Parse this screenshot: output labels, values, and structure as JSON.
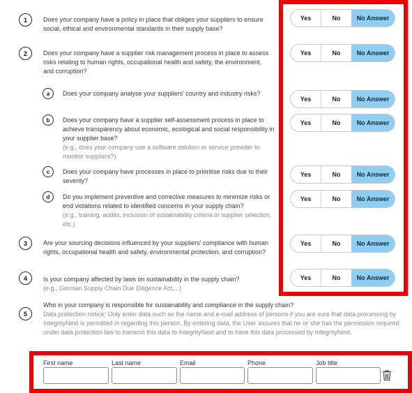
{
  "answer_labels": {
    "yes": "Yes",
    "no": "No",
    "na": "No Answer"
  },
  "questions": [
    {
      "num": "1",
      "text": "Does your company have a policy in place that obliges your suppliers to ensure social, ethical and environmental standards in their supply base?",
      "hint": "",
      "answer": "No Answer"
    },
    {
      "num": "2",
      "text": "Does your company have a supplier risk management process in place to assess risks relating to human rights, occupational health and safety, the environment, and corruption?",
      "hint": "",
      "answer": "No Answer"
    },
    {
      "num": "a",
      "text": "Does your company analyse your suppliers' country and industry risks?",
      "hint": "",
      "answer": "No Answer"
    },
    {
      "num": "b",
      "text": "Does your company have a supplier self-assessment process in place to achieve transparency about economic, ecological and social responsibility in your supplier base?",
      "hint": "(e.g., does your company use a software solution or service provider to monitor suppliers?)",
      "answer": "No Answer"
    },
    {
      "num": "c",
      "text": "Does your company have processes in place to prioritise risks due to their severity?",
      "hint": "",
      "answer": "No Answer"
    },
    {
      "num": "d",
      "text": "Do you implement preventive and corrective measures to minimize risks or end violations related to identified concerns in your supply chain?",
      "hint": "(e.g., training, audits, inclusion of sustainability criteria in supplier selection, etc.)",
      "answer": "No Answer"
    },
    {
      "num": "3",
      "text": "Are your sourcing decisions influenced by your suppliers' compliance with human rights, occupational health and safety, environmental protection, and corruption?",
      "hint": "",
      "answer": "No Answer"
    },
    {
      "num": "4",
      "text": "Is your company affected by laws on sustainability in the supply chain?",
      "hint": "(e.g., German Supply Chain Due Diligence Act,...)",
      "answer": "No Answer"
    }
  ],
  "q5": {
    "num": "5",
    "text": "Who in your company is responsible for sustainability and compliance in the supply chain?",
    "notice": "Data protection notice: Only enter data such as the name and e-mail address of persons if you are sure that data processing by IntegrityNext is permitted in regarding this person. By entering data, the User assures that he or she has the permission required under data protection law to transmit this data to IntegrityNext and to have this data processed by IntegrityNext."
  },
  "contact_fields": {
    "first_name": {
      "label": "First name",
      "value": ""
    },
    "last_name": {
      "label": "Last name",
      "value": ""
    },
    "email": {
      "label": "Email",
      "value": ""
    },
    "phone": {
      "label": "Phone",
      "value": ""
    },
    "job_title": {
      "label": "Job title",
      "value": ""
    }
  },
  "icons": {
    "delete": "trash-icon"
  },
  "colors": {
    "selected_answer_bg": "#8fcef0",
    "highlight_border": "#f00000"
  }
}
